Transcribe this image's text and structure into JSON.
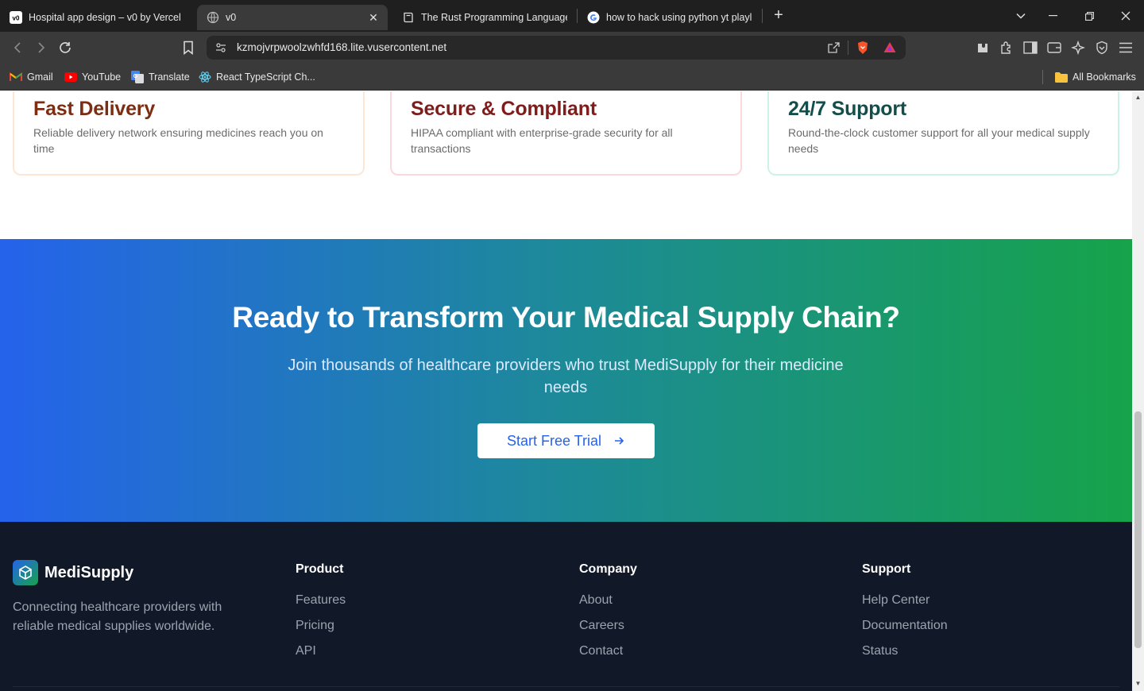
{
  "browser": {
    "tabs": [
      {
        "title": "Hospital app design – v0 by Vercel",
        "icon": "v0-icon",
        "active": false
      },
      {
        "title": "v0",
        "icon": "globe-icon",
        "active": true
      },
      {
        "title": "The Rust Programming Language - Th",
        "icon": "book-icon",
        "active": false
      },
      {
        "title": "how to hack using python yt playlists",
        "icon": "google-icon",
        "active": false
      }
    ],
    "url": "kzmojvrpwoolzwhfd168.lite.vusercontent.net",
    "bookmarks": [
      {
        "label": "Gmail",
        "icon": "gmail-icon"
      },
      {
        "label": "YouTube",
        "icon": "youtube-icon"
      },
      {
        "label": "Translate",
        "icon": "translate-icon"
      },
      {
        "label": "React TypeScript Ch...",
        "icon": "react-icon"
      }
    ],
    "all_bookmarks": "All Bookmarks"
  },
  "features": [
    {
      "title": "Fast Delivery",
      "description": "Reliable delivery network ensuring medicines reach you on time",
      "accent": "#7c2d12",
      "border": "#fde7d4"
    },
    {
      "title": "Secure & Compliant",
      "description": "HIPAA compliant with enterprise-grade security for all transactions",
      "accent": "#7f1d1d",
      "border": "#fcd9d9"
    },
    {
      "title": "24/7 Support",
      "description": "Round-the-clock customer support for all your medical supply needs",
      "accent": "#134e4a",
      "border": "#ccf3e8"
    }
  ],
  "cta": {
    "heading": "Ready to Transform Your Medical Supply Chain?",
    "subtext": "Join thousands of healthcare providers who trust MediSupply for their medicine needs",
    "button": "Start Free Trial",
    "gradient": [
      "#2563eb",
      "#16a34a"
    ]
  },
  "footer": {
    "brand": "MediSupply",
    "tagline": "Connecting healthcare providers with reliable medical supplies worldwide.",
    "columns": [
      {
        "title": "Product",
        "links": [
          "Features",
          "Pricing",
          "API"
        ]
      },
      {
        "title": "Company",
        "links": [
          "About",
          "Careers",
          "Contact"
        ]
      },
      {
        "title": "Support",
        "links": [
          "Help Center",
          "Documentation",
          "Status"
        ]
      }
    ]
  }
}
